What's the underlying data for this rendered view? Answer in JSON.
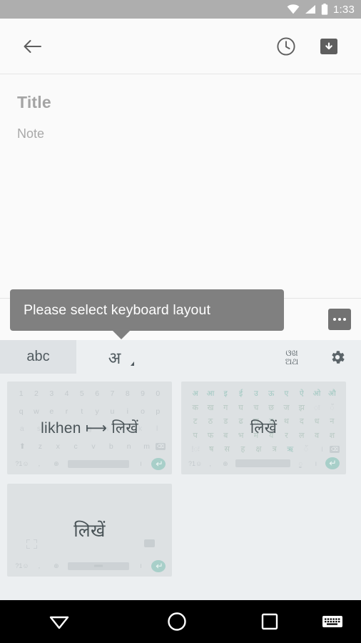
{
  "status_bar": {
    "time": "1:33",
    "icons": [
      "wifi-icon",
      "cellular-signal-icon",
      "battery-icon"
    ],
    "background_color": "#aeaeae"
  },
  "app_bar": {
    "back_label": "back-arrow",
    "actions": [
      {
        "name": "reminder-clock-icon",
        "label": "Reminder"
      },
      {
        "name": "archive-icon",
        "label": "Archive"
      }
    ]
  },
  "note": {
    "title_placeholder": "Title",
    "body_placeholder": "Note"
  },
  "tooltip": {
    "text": "Please select keyboard layout",
    "background_color": "#808080",
    "text_color": "#ffffff"
  },
  "keyboard": {
    "overflow_label": "overflow-menu",
    "tabs": [
      {
        "id": "abc",
        "label": "abc",
        "selected": false
      },
      {
        "id": "devanagari",
        "label": "अ",
        "selected": true,
        "has_dropdown": true
      },
      {
        "id": "script",
        "label": "ଓଖ\nଅଥ",
        "selected": false
      },
      {
        "id": "settings",
        "label": "gear-icon",
        "selected": false
      }
    ],
    "layouts": [
      {
        "id": "transliteration",
        "overlay": "likhen ⟼ लिखें",
        "rows": [
          [
            "1",
            "2",
            "3",
            "4",
            "5",
            "6",
            "7",
            "8",
            "9",
            "0"
          ],
          [
            "q",
            "w",
            "e",
            "r",
            "t",
            "y",
            "u",
            "i",
            "o",
            "p"
          ],
          [
            "a",
            "s",
            "d",
            "f",
            "g",
            "h",
            "j",
            "k",
            "l"
          ],
          [
            "⇧",
            "z",
            "x",
            "c",
            "v",
            "b",
            "n",
            "m",
            "⌫"
          ],
          [
            "?1☺",
            ",",
            "⊕",
            "space",
            ".",
            "⏎"
          ]
        ]
      },
      {
        "id": "native-devanagari",
        "overlay": "लिखें",
        "rows": [
          [
            "अ",
            "आ",
            "इ",
            "ई",
            "उ",
            "ऊ",
            "ए",
            "ऐ",
            "ओ",
            "औ"
          ],
          [
            "क",
            "ख",
            "ग",
            "घ",
            "च",
            "छ",
            "ज",
            "झ",
            "ः",
            "ँ"
          ],
          [
            "ट",
            "ठ",
            "ड",
            "ढ",
            "ण",
            "त",
            "थ",
            "द",
            "ध",
            "न"
          ],
          [
            "प",
            "फ",
            "ब",
            "भ",
            "म",
            "य",
            "र",
            "ल",
            "व",
            "श"
          ],
          [
            "!ः",
            "ष",
            "स",
            "ह",
            "क्ष",
            "त्र",
            "ऋ",
            "ॅ",
            "।",
            "⌫"
          ],
          [
            "?1☺",
            ",",
            "⊕",
            "space",
            "ॗ",
            "।",
            "ः",
            "⏎"
          ]
        ]
      },
      {
        "id": "handwriting",
        "overlay": "लिखें",
        "rows": [
          [
            "handwriting-pad-icon",
            "⌫"
          ],
          [
            "?1☺",
            ",",
            "⊕",
            "space",
            "⌷",
            "।",
            "⏎"
          ]
        ]
      }
    ],
    "colors": {
      "panel_background": "#eceff1",
      "card_background": "#dde1e3",
      "tab_selected_background": "#dee2e5",
      "enter_key_accent": "#a8cfc9"
    }
  },
  "nav_bar": {
    "buttons": [
      {
        "name": "back-nav-button",
        "icon": "triangle-down-icon"
      },
      {
        "name": "home-nav-button",
        "icon": "circle-icon"
      },
      {
        "name": "recents-nav-button",
        "icon": "square-icon"
      },
      {
        "name": "keyboard-switch-button",
        "icon": "keyboard-icon"
      }
    ],
    "background_color": "#000000"
  }
}
